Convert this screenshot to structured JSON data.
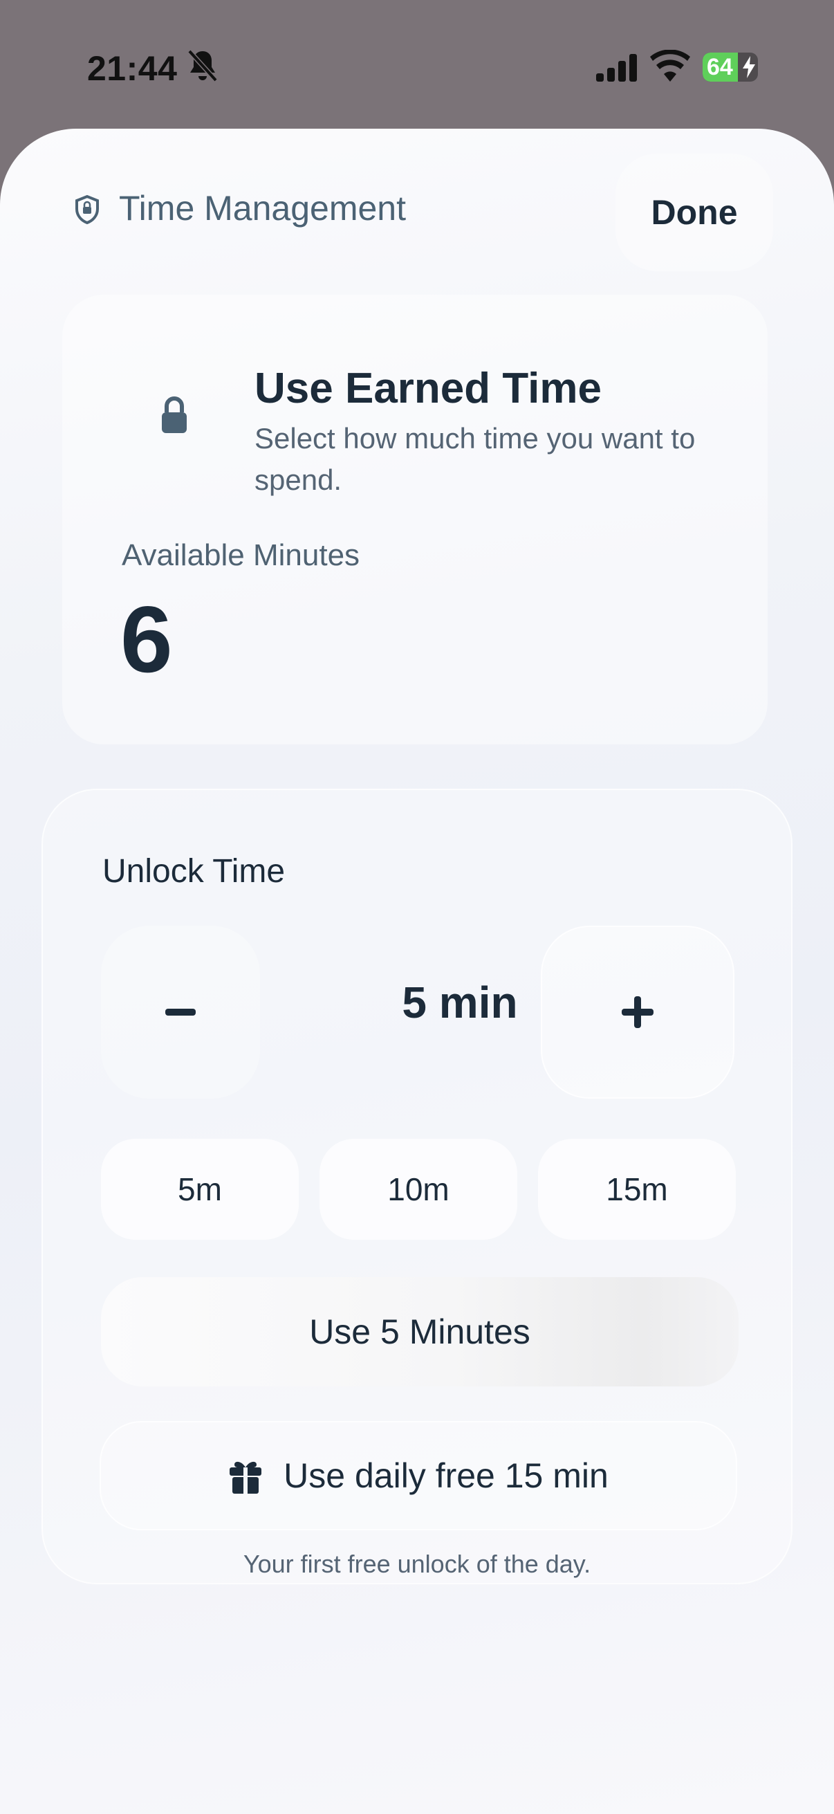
{
  "status_bar": {
    "time": "21:44",
    "battery_level": "64",
    "battery_fraction": 0.64
  },
  "nav": {
    "title": "Time Management",
    "done_label": "Done"
  },
  "earned": {
    "title": "Use Earned Time",
    "subtitle": "Select how much time you want to spend.",
    "available_label": "Available Minutes",
    "available_value": "6"
  },
  "unlock": {
    "title": "Unlock Time",
    "amount": "5 min",
    "presets": [
      "5m",
      "10m",
      "15m"
    ],
    "use_label": "Use 5 Minutes",
    "free_label": "Use daily free 15 min",
    "free_note": "Your first free unlock of the day."
  },
  "colors": {
    "text_primary": "#1c2b3a",
    "text_secondary": "#4b6274",
    "battery_green": "#5fcf5a"
  },
  "icons": [
    "bell-slash-icon",
    "signal-icon",
    "wifi-icon",
    "battery-icon",
    "shield-icon",
    "lock-icon",
    "minus-icon",
    "plus-icon",
    "gift-icon"
  ]
}
